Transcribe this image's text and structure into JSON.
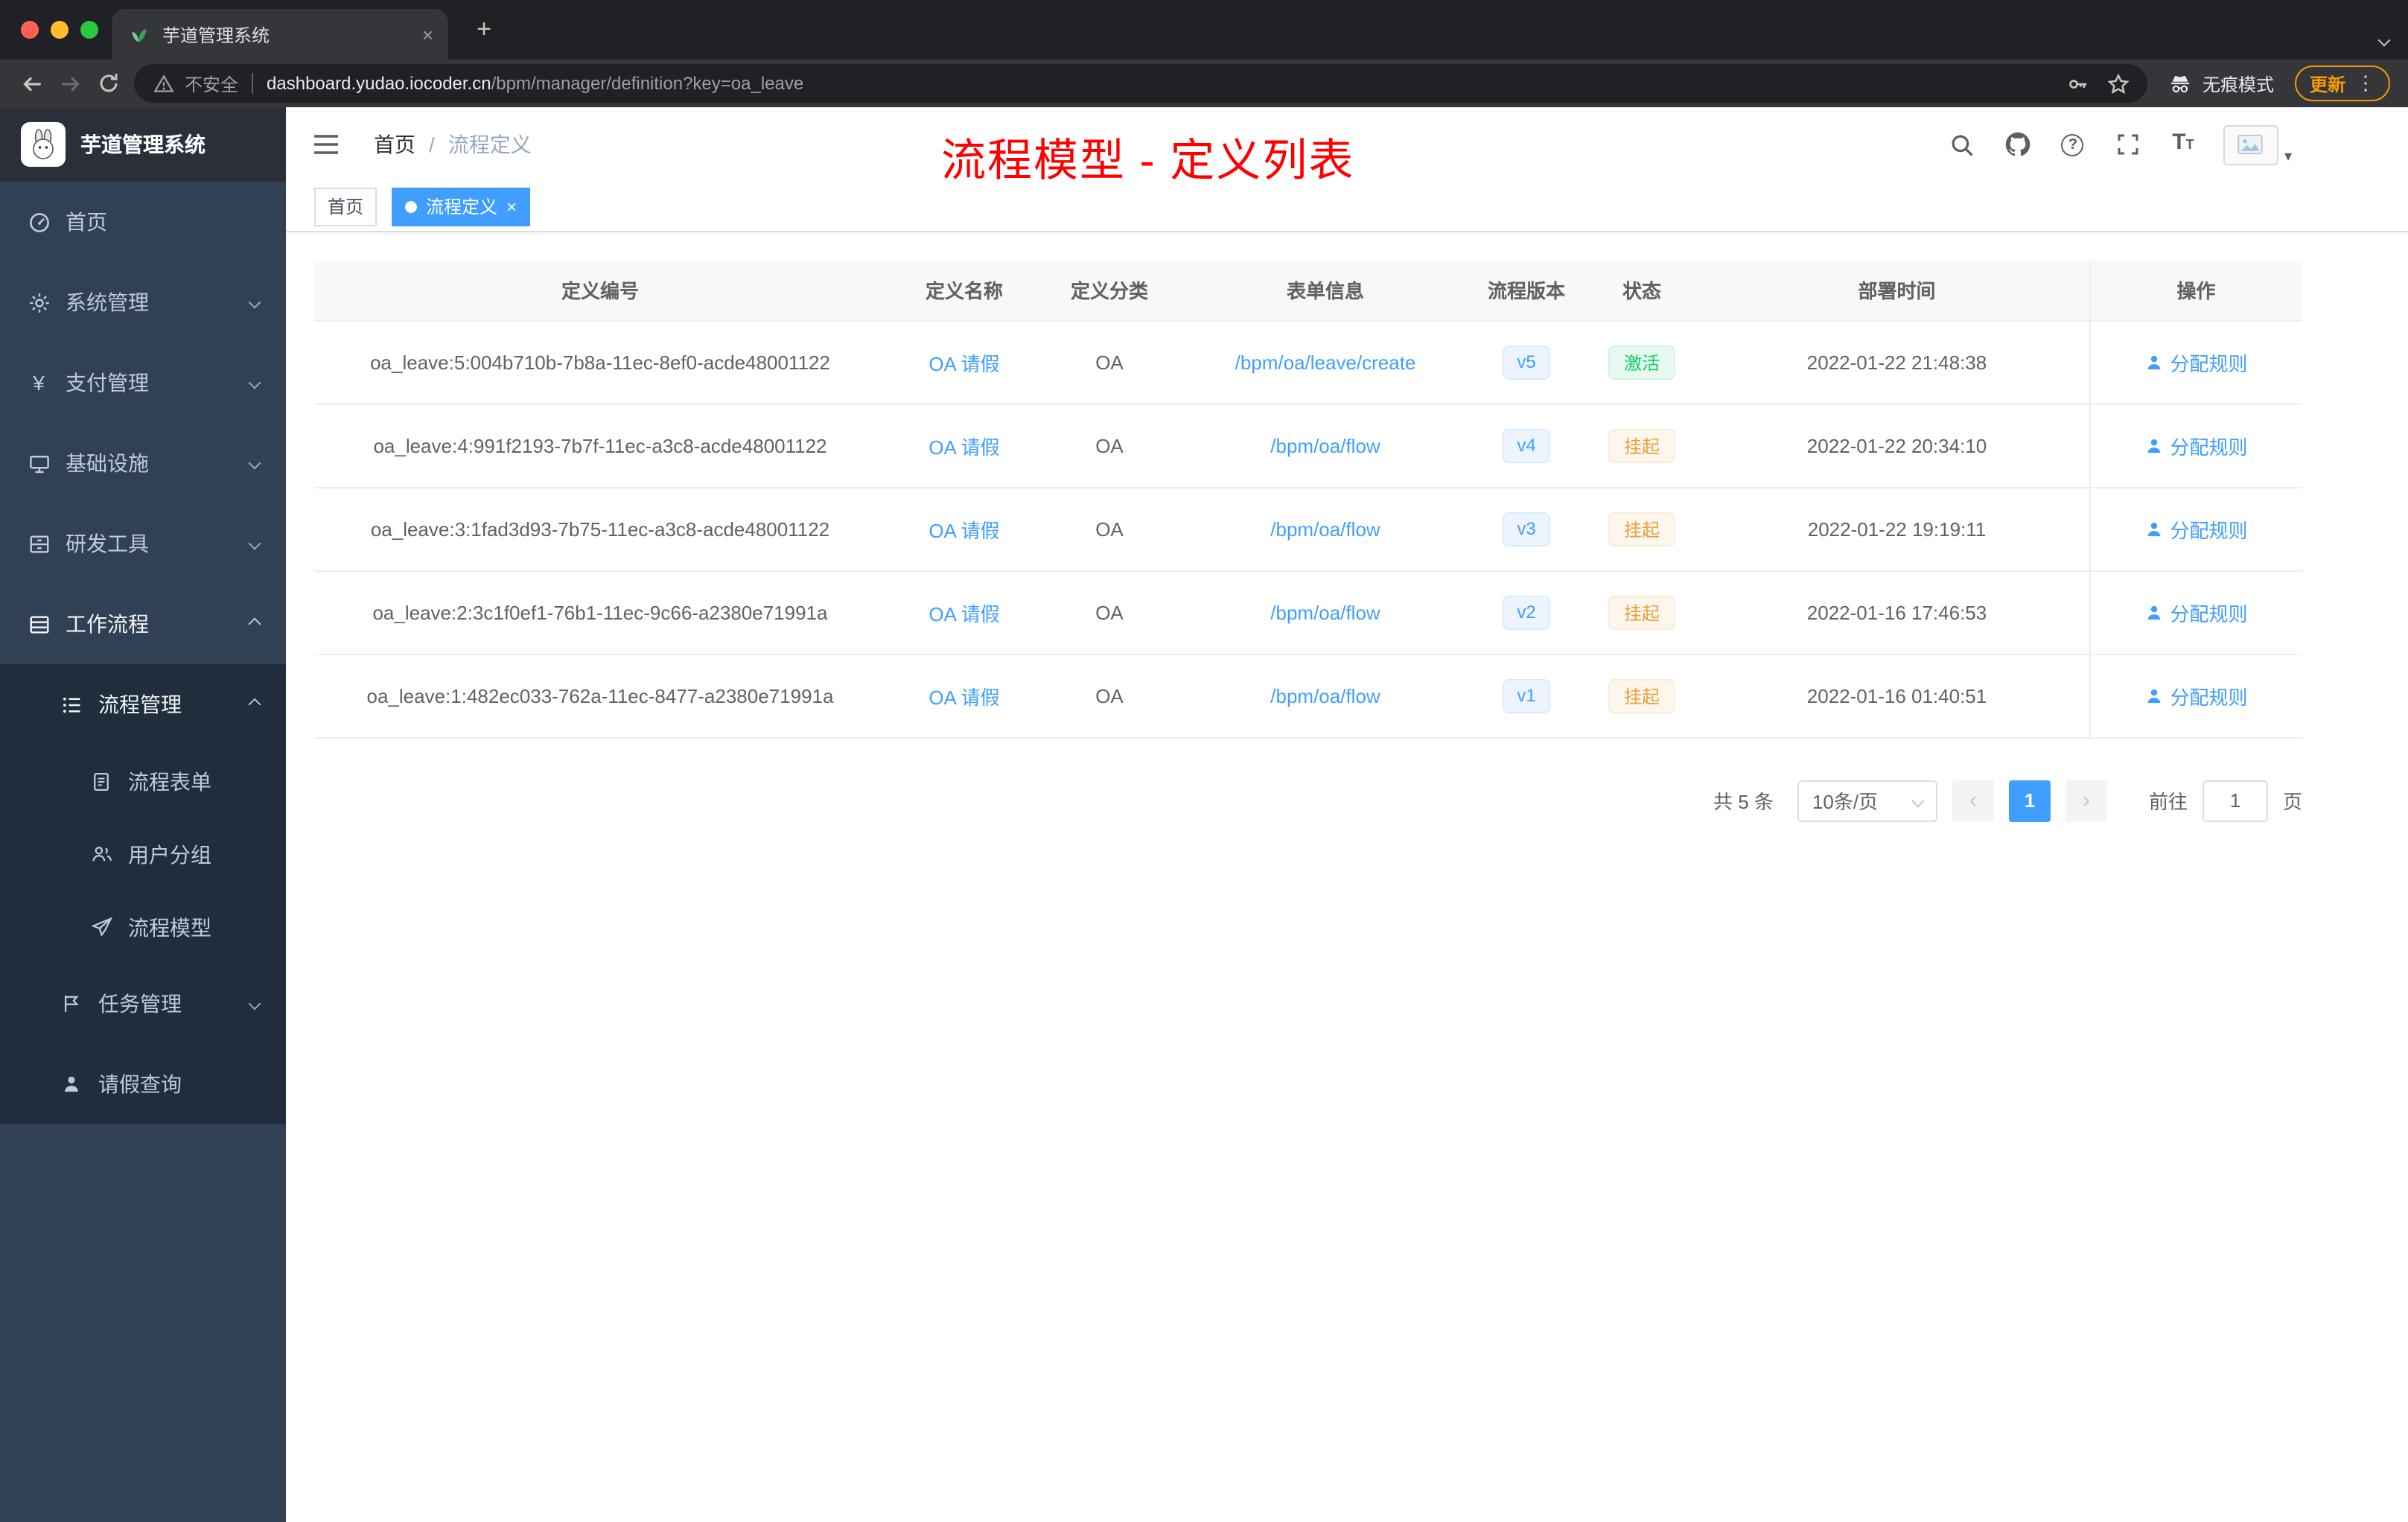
{
  "browser": {
    "tab_title": "芋道管理系统",
    "security_warning": "不安全",
    "url_domain": "dashboard.yudao.iocoder.cn",
    "url_path": "/bpm/manager/definition?key=oa_leave",
    "incognito_label": "无痕模式",
    "update_label": "更新"
  },
  "sidebar": {
    "logo_title": "芋道管理系统",
    "items": [
      {
        "label": "首页"
      },
      {
        "label": "系统管理"
      },
      {
        "label": "支付管理"
      },
      {
        "label": "基础设施"
      },
      {
        "label": "研发工具"
      },
      {
        "label": "工作流程"
      },
      {
        "label": "流程管理"
      },
      {
        "label": "流程表单"
      },
      {
        "label": "用户分组"
      },
      {
        "label": "流程模型"
      },
      {
        "label": "任务管理"
      },
      {
        "label": "请假查询"
      }
    ]
  },
  "header": {
    "breadcrumb_home": "首页",
    "breadcrumb_separator": "/",
    "breadcrumb_current": "流程定义",
    "annotation": "流程模型 - 定义列表"
  },
  "tags": [
    {
      "label": "首页",
      "active": false
    },
    {
      "label": "流程定义",
      "active": true
    }
  ],
  "table": {
    "columns": [
      "定义编号",
      "定义名称",
      "定义分类",
      "表单信息",
      "流程版本",
      "状态",
      "部署时间",
      "操作"
    ],
    "rows": [
      {
        "id": "oa_leave:5:004b710b-7b8a-11ec-8ef0-acde48001122",
        "name": "OA 请假",
        "category": "OA",
        "form": "/bpm/oa/leave/create",
        "version": "v5",
        "status": "激活",
        "status_type": "success",
        "time": "2022-01-22 21:48:38",
        "action": "分配规则"
      },
      {
        "id": "oa_leave:4:991f2193-7b7f-11ec-a3c8-acde48001122",
        "name": "OA 请假",
        "category": "OA",
        "form": "/bpm/oa/flow",
        "version": "v4",
        "status": "挂起",
        "status_type": "warning",
        "time": "2022-01-22 20:34:10",
        "action": "分配规则"
      },
      {
        "id": "oa_leave:3:1fad3d93-7b75-11ec-a3c8-acde48001122",
        "name": "OA 请假",
        "category": "OA",
        "form": "/bpm/oa/flow",
        "version": "v3",
        "status": "挂起",
        "status_type": "warning",
        "time": "2022-01-22 19:19:11",
        "action": "分配规则"
      },
      {
        "id": "oa_leave:2:3c1f0ef1-76b1-11ec-9c66-a2380e71991a",
        "name": "OA 请假",
        "category": "OA",
        "form": "/bpm/oa/flow",
        "version": "v2",
        "status": "挂起",
        "status_type": "warning",
        "time": "2022-01-16 17:46:53",
        "action": "分配规则"
      },
      {
        "id": "oa_leave:1:482ec033-762a-11ec-8477-a2380e71991a",
        "name": "OA 请假",
        "category": "OA",
        "form": "/bpm/oa/flow",
        "version": "v1",
        "status": "挂起",
        "status_type": "warning",
        "time": "2022-01-16 01:40:51",
        "action": "分配规则"
      }
    ]
  },
  "pagination": {
    "total": "共 5 条",
    "page_size": "10条/页",
    "current_page": "1",
    "goto_label": "前往",
    "goto_value": "1",
    "page_unit": "页"
  },
  "icons": {
    "close": "×",
    "plus": "+",
    "kebab": "⋮",
    "question": "?",
    "font_size_big": "T",
    "font_size_small": "T",
    "caret_down": "▾",
    "prev": "‹",
    "next": "›",
    "yen": "¥"
  },
  "colors": {
    "accent": "#409eff",
    "success": "#13ce66",
    "warning": "#e6a23c",
    "annotation_red": "#ff0000",
    "sidebar_bg": "#304156",
    "sidebar_submenu_bg": "#1f2d3d"
  }
}
